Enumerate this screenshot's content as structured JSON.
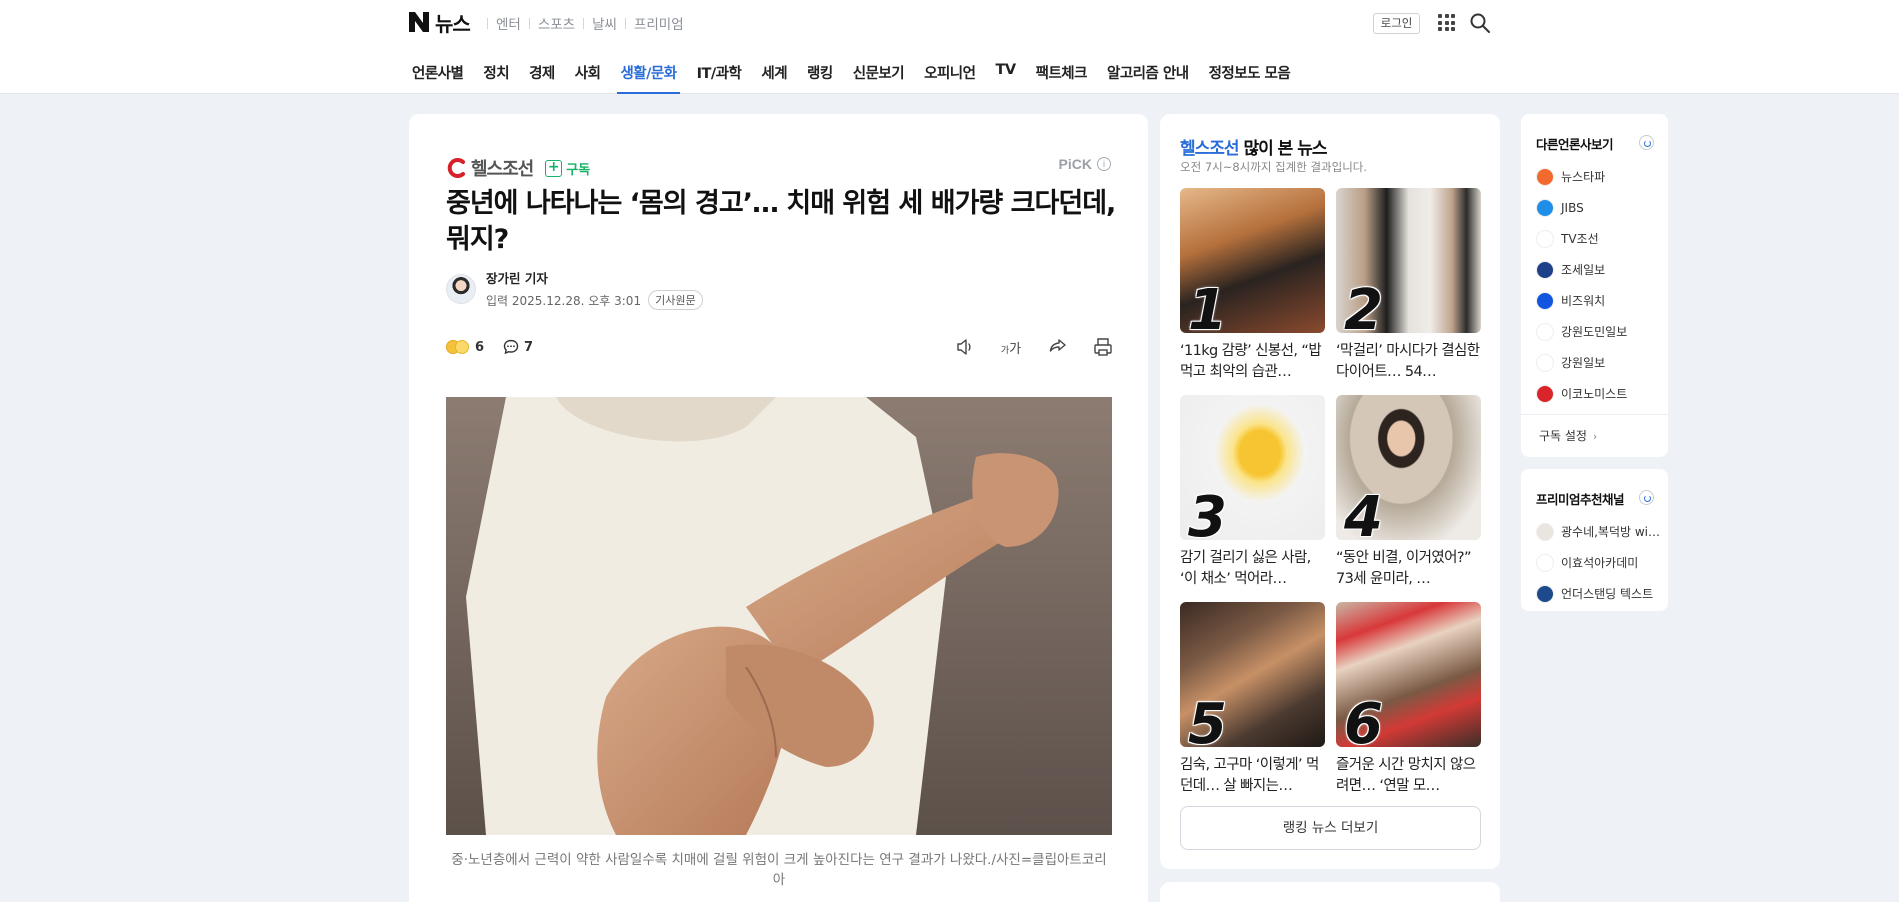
{
  "header": {
    "logo_text": "뉴스",
    "subnav": [
      "엔터",
      "스포츠",
      "날씨",
      "프리미엄"
    ],
    "login_label": "로그인",
    "tabs": [
      {
        "label": "언론사별",
        "active": false
      },
      {
        "label": "정치",
        "active": false
      },
      {
        "label": "경제",
        "active": false
      },
      {
        "label": "사회",
        "active": false
      },
      {
        "label": "생활/문화",
        "active": true
      },
      {
        "label": "IT/과학",
        "active": false
      },
      {
        "label": "세계",
        "active": false
      },
      {
        "label": "랭킹",
        "active": false
      },
      {
        "label": "신문보기",
        "active": false
      },
      {
        "label": "오피니언",
        "active": false
      },
      {
        "label": "TV",
        "active": false
      },
      {
        "label": "팩트체크",
        "active": false
      },
      {
        "label": "알고리즘 안내",
        "active": false
      },
      {
        "label": "정정보도 모음",
        "active": false
      }
    ],
    "accent_color": "#2a6dd8"
  },
  "article": {
    "press_name": "헬스조선",
    "subscribe_label": "구독",
    "pick_label": "PiCK",
    "title": "중년에 나타나는 ‘몸의 경고’… 치매 위험 세 배가량 크다던데, 뭐지?",
    "author_name": "장가린 기자",
    "date_text": "입력 2025.12.28. 오후 3:01",
    "original_label": "기사원문",
    "reaction_count": "6",
    "comment_count": "7",
    "font_size_label": "가",
    "caption": "중·노년층에서 근력이 약한 사람일수록 치매에 걸릴 위험이 크게 높아진다는 연구 결과가 나왔다./사진=클립아트코리아"
  },
  "ranking": {
    "press_name": "헬스조선",
    "title_suffix": " 많이 본 뉴스",
    "subtitle": "오전 7시~8시까지 집계한 결과입니다.",
    "items": [
      {
        "rank": "1",
        "text": "‘11kg 감량’ 신봉선, “밥먹고 최악의 습관…"
      },
      {
        "rank": "2",
        "text": "‘막걸리’ 마시다가 결심한 다이어트… 54…"
      },
      {
        "rank": "3",
        "text": "감기 걸리기 싫은 사람, ‘이 채소’ 먹어라…"
      },
      {
        "rank": "4",
        "text": "“동안 비결, 이거였어?” 73세 윤미라, …"
      },
      {
        "rank": "5",
        "text": "김숙, 고구마 ‘이렇게’ 먹던데… 살 빠지는…"
      },
      {
        "rank": "6",
        "text": "즐거운 시간 망치지 않으려면… ‘연말 모…"
      }
    ],
    "more_label": "랭킹 뉴스 더보기"
  },
  "others": {
    "title": "다른언론사보기",
    "items": [
      {
        "name": "뉴스타파",
        "color": "#f26a2d"
      },
      {
        "name": "JIBS",
        "color": "#1f8ee8"
      },
      {
        "name": "TV조선",
        "color": "#ffffff"
      },
      {
        "name": "조세일보",
        "color": "#1e3f8a"
      },
      {
        "name": "비즈워치",
        "color": "#1255e0"
      },
      {
        "name": "강원도민일보",
        "color": "#ffffff"
      },
      {
        "name": "강원일보",
        "color": "#ffffff"
      },
      {
        "name": "이코노미스트",
        "color": "#d9252a"
      }
    ],
    "setting_label": "구독 설정"
  },
  "premium": {
    "title": "프리미엄추천채널",
    "items": [
      {
        "name": "광수네,복덕방 wi…",
        "color": "#e9e6e0"
      },
      {
        "name": "이효석아카데미",
        "color": "#ffffff"
      },
      {
        "name": "언더스탠딩 텍스트",
        "color": "#1c4a8c"
      }
    ]
  }
}
